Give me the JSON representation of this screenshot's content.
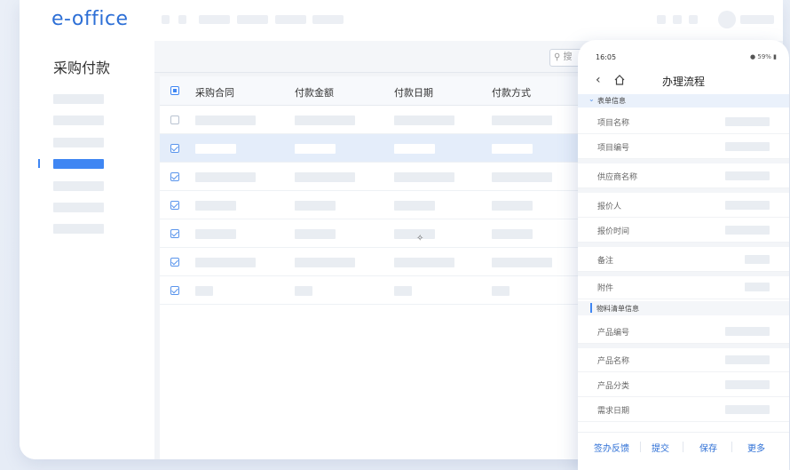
{
  "app": {
    "logo": "e-office"
  },
  "sidebar": {
    "title": "采购付款",
    "active_index": 3,
    "item_count": 6
  },
  "table": {
    "columns": [
      "采购合同",
      "付款金额",
      "付款日期",
      "付款方式"
    ],
    "rows": [
      {
        "checked": false,
        "selected": false
      },
      {
        "checked": true,
        "selected": true
      },
      {
        "checked": true,
        "selected": false
      },
      {
        "checked": true,
        "selected": false
      },
      {
        "checked": true,
        "selected": false
      },
      {
        "checked": true,
        "selected": false
      },
      {
        "checked": true,
        "selected": false
      }
    ]
  },
  "search": {
    "placeholder": "搜"
  },
  "phone": {
    "status_time": "16:05",
    "status_right": "59%",
    "nav_title": "办理流程",
    "section1": "表单信息",
    "fields1": [
      "项目名称",
      "项目编号",
      "供应商名称",
      "报价人",
      "报价时间",
      "备注",
      "附件"
    ],
    "section2": "物料清单信息",
    "fields2": [
      "产品编号",
      "产品名称",
      "产品分类",
      "需求日期"
    ],
    "actions": [
      "签办反馈",
      "提交",
      "保存",
      "更多"
    ]
  },
  "colors": {
    "accent": "#3f86f3",
    "logo": "#2d6fd6",
    "selected_row": "#e4edfa"
  }
}
